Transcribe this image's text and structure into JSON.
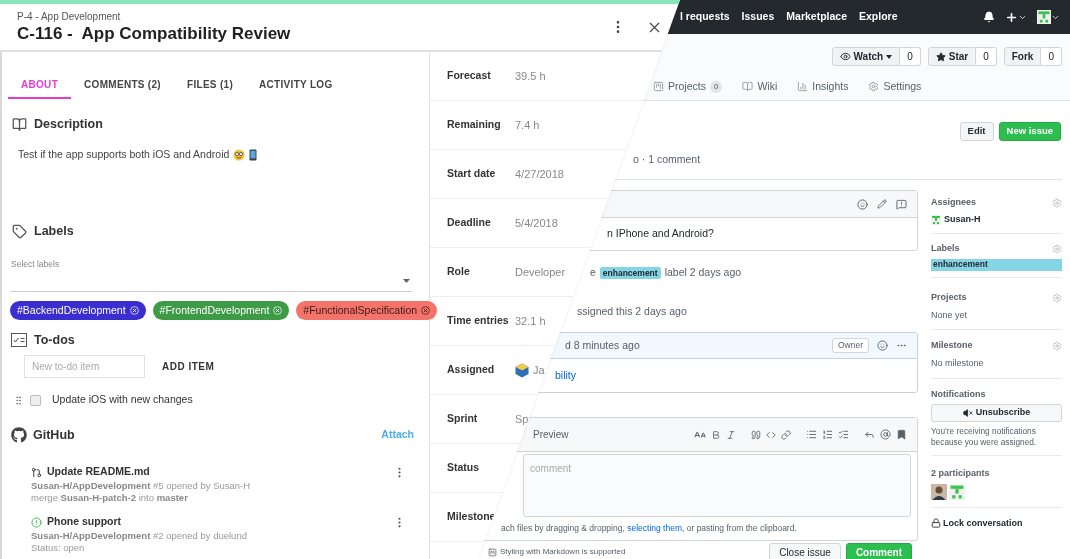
{
  "task_panel": {
    "project": "P-4 - App Development",
    "title": "C-116 -  App Compatibility Review",
    "tabs": [
      {
        "label": "ABOUT",
        "selected": true
      },
      {
        "label": "COMMENTS (2)",
        "selected": false
      },
      {
        "label": "FILES (1)",
        "selected": false
      },
      {
        "label": "ACTIVITY LOG",
        "selected": false
      }
    ],
    "description": {
      "heading": "Description",
      "text": "Test if the app supports both iOS and Android"
    },
    "labels": {
      "heading": "Labels",
      "field_label": "Select labels",
      "chips": [
        {
          "label": "#BackendDevelopment",
          "color": "#3a2ed0"
        },
        {
          "label": "#FrontendDevelopment",
          "color": "#3d9a47"
        },
        {
          "label": "#FunctionalSpecification",
          "color": "#f4736a"
        }
      ]
    },
    "todos": {
      "heading": "To-dos",
      "placeholder": "New to-do item",
      "add_button": "ADD ITEM",
      "items": [
        {
          "text": "Update iOS with new changes",
          "checked": false
        }
      ]
    },
    "github": {
      "heading": "GitHub",
      "attach": "Attach",
      "items": [
        {
          "kind": "pull_request",
          "title": "Update README.md",
          "lines": [
            "**Susan-H/AppDevelopment** #5 opened by Susan-H",
            "merge **Susan-H-patch-2** into **master**"
          ]
        },
        {
          "kind": "issue",
          "title": "Phone support",
          "lines": [
            "**Susan-H/AppDevelopment** #2 opened by duelund",
            "Status: open"
          ]
        }
      ]
    }
  },
  "attributes": [
    {
      "kind": "text",
      "label": "Forecast",
      "value": "39.5 h"
    },
    {
      "kind": "text",
      "label": "Remaining",
      "value": "7.4 h"
    },
    {
      "kind": "text",
      "label": "Start date",
      "value": "4/27/2018"
    },
    {
      "kind": "text",
      "label": "Deadline",
      "value": "5/4/2018"
    },
    {
      "kind": "text",
      "label": "Role",
      "value": "Developer"
    },
    {
      "kind": "text",
      "label": "Time entries",
      "value": "32.1 h"
    },
    {
      "kind": "person",
      "label": "Assigned",
      "value": "Ja"
    },
    {
      "kind": "text",
      "label": "Sprint",
      "value": "Sp"
    },
    {
      "kind": "text",
      "label": "Status"
    },
    {
      "kind": "text",
      "label": "Milestone"
    }
  ],
  "github_page": {
    "nav": [
      "l requests",
      "Issues",
      "Marketplace",
      "Explore"
    ],
    "repo_buttons": [
      {
        "kind": "watch",
        "label": "Watch",
        "count": "0"
      },
      {
        "kind": "star",
        "label": "Star",
        "count": "0"
      },
      {
        "kind": "fork",
        "label": "Fork",
        "count": "0"
      }
    ],
    "tabs": [
      {
        "kind": "projects",
        "label": "Projects",
        "count": "0"
      },
      {
        "kind": "wiki",
        "label": "Wiki"
      },
      {
        "kind": "insights",
        "label": "Insights"
      },
      {
        "kind": "settings",
        "label": "Settings"
      }
    ],
    "actions": [
      "Edit",
      "New issue"
    ],
    "meta": "o · 1 comment",
    "comment_body": "n IPhone and Android?",
    "label_event": {
      "prefix": "e",
      "label": "enhancement",
      "color": "#84d6e6",
      "suffix": "label 2 days ago"
    },
    "assign_event": "ssigned this 2 days ago",
    "comment2": {
      "header": "d 8 minutes ago",
      "badge": "Owner",
      "body": "bility"
    },
    "editor": {
      "tab": "Preview",
      "placeholder": "comment",
      "hint_before": "ach files by dragging & dropping, ",
      "hint_link": "selecting them",
      "hint_after": ", or pasting from the clipboard.",
      "markdown_note": "Styling with Markdown is supported",
      "buttons": [
        "Close issue",
        "Comment"
      ]
    },
    "sidebar": {
      "assignees": {
        "heading": "Assignees",
        "name": "Susan-H"
      },
      "labels": {
        "heading": "Labels",
        "items": [
          {
            "name": "enhancement",
            "color": "#84d6e6"
          }
        ]
      },
      "projects": {
        "heading": "Projects",
        "text": "None yet"
      },
      "milestone": {
        "heading": "Milestone",
        "text": "No milestone"
      },
      "notifications": {
        "heading": "Notifications",
        "button": "Unsubscribe",
        "note": "You’re receiving notifications because you were assigned."
      },
      "participants": {
        "heading": "2 participants"
      },
      "lock": "Lock conversation"
    }
  }
}
